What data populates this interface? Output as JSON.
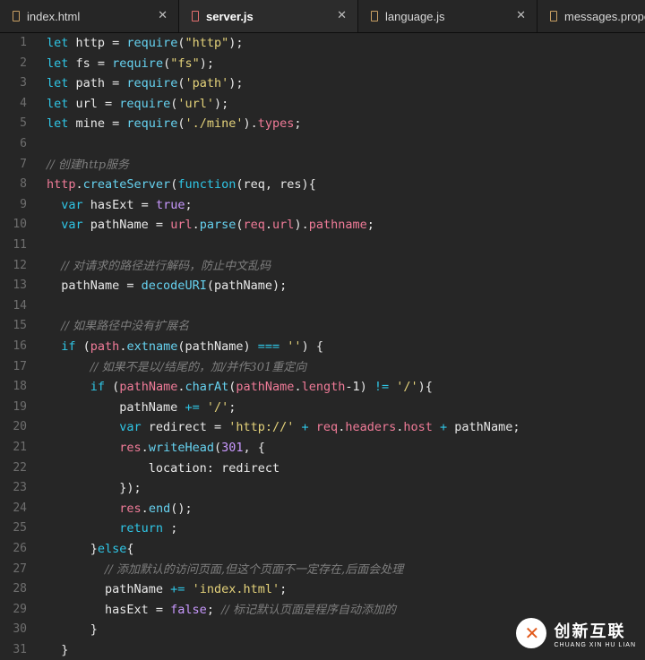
{
  "tabs": [
    {
      "label": "index.html",
      "close": "✕"
    },
    {
      "label": "server.js",
      "close": "✕"
    },
    {
      "label": "language.js",
      "close": "✕"
    },
    {
      "label": "messages.properties",
      "close": ""
    }
  ],
  "lines": [
    {
      "n": "1",
      "tokens": [
        [
          "k",
          "let"
        ],
        [
          "p",
          " http = "
        ],
        [
          "fn",
          "require"
        ],
        [
          "p",
          "("
        ],
        [
          "s",
          "\"http\""
        ],
        [
          "p",
          ");"
        ]
      ]
    },
    {
      "n": "2",
      "tokens": [
        [
          "k",
          "let"
        ],
        [
          "p",
          " fs = "
        ],
        [
          "fn",
          "require"
        ],
        [
          "p",
          "("
        ],
        [
          "s",
          "\"fs\""
        ],
        [
          "p",
          ");"
        ]
      ]
    },
    {
      "n": "3",
      "tokens": [
        [
          "k",
          "let"
        ],
        [
          "p",
          " path = "
        ],
        [
          "fn",
          "require"
        ],
        [
          "p",
          "("
        ],
        [
          "s",
          "'path'"
        ],
        [
          "p",
          ");"
        ]
      ]
    },
    {
      "n": "4",
      "tokens": [
        [
          "k",
          "let"
        ],
        [
          "p",
          " url = "
        ],
        [
          "fn",
          "require"
        ],
        [
          "p",
          "("
        ],
        [
          "s",
          "'url'"
        ],
        [
          "p",
          ");"
        ]
      ]
    },
    {
      "n": "5",
      "tokens": [
        [
          "k",
          "let"
        ],
        [
          "p",
          " mine = "
        ],
        [
          "fn",
          "require"
        ],
        [
          "p",
          "("
        ],
        [
          "s",
          "'./mine'"
        ],
        [
          "p",
          ")."
        ],
        [
          "pink",
          "types"
        ],
        [
          "p",
          ";"
        ]
      ]
    },
    {
      "n": "6",
      "tokens": []
    },
    {
      "n": "7",
      "tokens": [
        [
          "c",
          "// 创建http服务"
        ]
      ]
    },
    {
      "n": "8",
      "tokens": [
        [
          "pink",
          "http"
        ],
        [
          "p",
          "."
        ],
        [
          "fn",
          "createServer"
        ],
        [
          "p",
          "("
        ],
        [
          "k",
          "function"
        ],
        [
          "p",
          "(req, res){"
        ]
      ]
    },
    {
      "n": "9",
      "tokens": [
        [
          "p",
          "  "
        ],
        [
          "k",
          "var"
        ],
        [
          "p",
          " hasExt = "
        ],
        [
          "pur",
          "true"
        ],
        [
          "p",
          ";"
        ]
      ]
    },
    {
      "n": "10",
      "tokens": [
        [
          "p",
          "  "
        ],
        [
          "k",
          "var"
        ],
        [
          "p",
          " pathName = "
        ],
        [
          "pink",
          "url"
        ],
        [
          "p",
          "."
        ],
        [
          "fn",
          "parse"
        ],
        [
          "p",
          "("
        ],
        [
          "pink",
          "req"
        ],
        [
          "p",
          "."
        ],
        [
          "pink",
          "url"
        ],
        [
          "p",
          ")."
        ],
        [
          "pink",
          "pathname"
        ],
        [
          "p",
          ";"
        ]
      ]
    },
    {
      "n": "11",
      "tokens": []
    },
    {
      "n": "12",
      "tokens": [
        [
          "p",
          "  "
        ],
        [
          "c",
          "// 对请求的路径进行解码，防止中文乱码"
        ]
      ]
    },
    {
      "n": "13",
      "tokens": [
        [
          "p",
          "  pathName = "
        ],
        [
          "fn",
          "decodeURI"
        ],
        [
          "p",
          "(pathName);"
        ]
      ]
    },
    {
      "n": "14",
      "tokens": []
    },
    {
      "n": "15",
      "tokens": [
        [
          "p",
          "  "
        ],
        [
          "c",
          "// 如果路径中没有扩展名"
        ]
      ]
    },
    {
      "n": "16",
      "tokens": [
        [
          "p",
          "  "
        ],
        [
          "k",
          "if"
        ],
        [
          "p",
          " ("
        ],
        [
          "pink",
          "path"
        ],
        [
          "p",
          "."
        ],
        [
          "fn",
          "extname"
        ],
        [
          "p",
          "(pathName) "
        ],
        [
          "k",
          "==="
        ],
        [
          "p",
          " "
        ],
        [
          "s",
          "''"
        ],
        [
          "p",
          ") {"
        ]
      ]
    },
    {
      "n": "17",
      "tokens": [
        [
          "p",
          "      "
        ],
        [
          "c",
          "// 如果不是以/结尾的，加/并作301重定向"
        ]
      ]
    },
    {
      "n": "18",
      "tokens": [
        [
          "p",
          "      "
        ],
        [
          "k",
          "if"
        ],
        [
          "p",
          " ("
        ],
        [
          "pink",
          "pathName"
        ],
        [
          "p",
          "."
        ],
        [
          "fn",
          "charAt"
        ],
        [
          "p",
          "("
        ],
        [
          "pink",
          "pathName"
        ],
        [
          "p",
          "."
        ],
        [
          "pink",
          "length"
        ],
        [
          "p",
          "-1) "
        ],
        [
          "k",
          "!="
        ],
        [
          "p",
          " "
        ],
        [
          "s",
          "'/'"
        ],
        [
          "p",
          "){"
        ]
      ]
    },
    {
      "n": "19",
      "tokens": [
        [
          "p",
          "          pathName "
        ],
        [
          "k",
          "+="
        ],
        [
          "p",
          " "
        ],
        [
          "s",
          "'/'"
        ],
        [
          "p",
          ";"
        ]
      ]
    },
    {
      "n": "20",
      "tokens": [
        [
          "p",
          "          "
        ],
        [
          "k",
          "var"
        ],
        [
          "p",
          " redirect = "
        ],
        [
          "s",
          "'http://'"
        ],
        [
          "p",
          " "
        ],
        [
          "k",
          "+"
        ],
        [
          "p",
          " "
        ],
        [
          "pink",
          "req"
        ],
        [
          "p",
          "."
        ],
        [
          "pink",
          "headers"
        ],
        [
          "p",
          "."
        ],
        [
          "pink",
          "host"
        ],
        [
          "p",
          " "
        ],
        [
          "k",
          "+"
        ],
        [
          "p",
          " pathName;"
        ]
      ]
    },
    {
      "n": "21",
      "tokens": [
        [
          "p",
          "          "
        ],
        [
          "pink",
          "res"
        ],
        [
          "p",
          "."
        ],
        [
          "fn",
          "writeHead"
        ],
        [
          "p",
          "("
        ],
        [
          "num",
          "301"
        ],
        [
          "p",
          ", {"
        ]
      ]
    },
    {
      "n": "22",
      "tokens": [
        [
          "p",
          "              location: redirect"
        ]
      ]
    },
    {
      "n": "23",
      "tokens": [
        [
          "p",
          "          });"
        ]
      ]
    },
    {
      "n": "24",
      "tokens": [
        [
          "p",
          "          "
        ],
        [
          "pink",
          "res"
        ],
        [
          "p",
          "."
        ],
        [
          "fn",
          "end"
        ],
        [
          "p",
          "();"
        ]
      ]
    },
    {
      "n": "25",
      "tokens": [
        [
          "p",
          "          "
        ],
        [
          "k",
          "return"
        ],
        [
          "p",
          " ;"
        ]
      ]
    },
    {
      "n": "26",
      "tokens": [
        [
          "p",
          "      }"
        ],
        [
          "k",
          "else"
        ],
        [
          "p",
          "{"
        ]
      ]
    },
    {
      "n": "27",
      "tokens": [
        [
          "p",
          "        "
        ],
        [
          "c",
          "// 添加默认的访问页面,但这个页面不一定存在,后面会处理"
        ]
      ]
    },
    {
      "n": "28",
      "tokens": [
        [
          "p",
          "        pathName "
        ],
        [
          "k",
          "+="
        ],
        [
          "p",
          " "
        ],
        [
          "s",
          "'index.html'"
        ],
        [
          "p",
          ";"
        ]
      ]
    },
    {
      "n": "29",
      "tokens": [
        [
          "p",
          "        hasExt = "
        ],
        [
          "pur",
          "false"
        ],
        [
          "p",
          "; "
        ],
        [
          "c",
          "// 标记默认页面是程序自动添加的"
        ]
      ]
    },
    {
      "n": "30",
      "tokens": [
        [
          "p",
          "      }"
        ]
      ]
    },
    {
      "n": "31",
      "tokens": [
        [
          "p",
          "  }"
        ]
      ]
    }
  ],
  "watermark": {
    "cn": "创新互联",
    "en": "CHUANG XIN HU LIAN"
  }
}
